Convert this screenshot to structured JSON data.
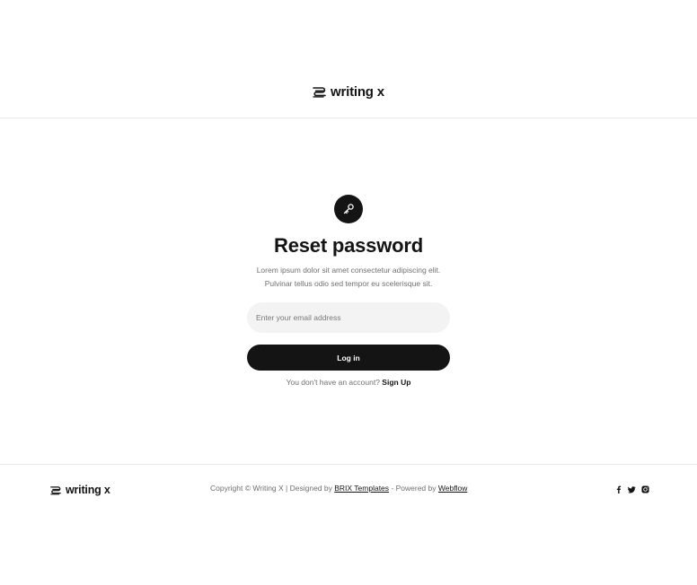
{
  "header": {
    "brand": "writing x"
  },
  "main": {
    "title": "Reset password",
    "subtitle_line1": "Lorem ipsum dolor sit amet consectetur adipiscing elit.",
    "subtitle_line2": "Pulvinar tellus odio sed tempor eu scelerisque sit.",
    "email_placeholder": "Enter your email address",
    "email_value": "",
    "submit_label": "Log in",
    "signup_prompt": "You don't have an account?",
    "signup_link": "Sign Up",
    "icon": "key-icon"
  },
  "footer": {
    "brand": "writing x",
    "copyright_text": "Copyright © Writing X | Designed by",
    "designer_link": "BRIX Templates",
    "powered_text": "- Powered by",
    "platform_link": "Webflow",
    "social_icons": [
      "facebook-icon",
      "twitter-icon",
      "instagram-icon"
    ]
  },
  "colors": {
    "primary": "#141414",
    "muted_text": "#707070",
    "input_background": "#f3f3f3",
    "divider": "#e8e8e8",
    "background": "#ffffff"
  }
}
